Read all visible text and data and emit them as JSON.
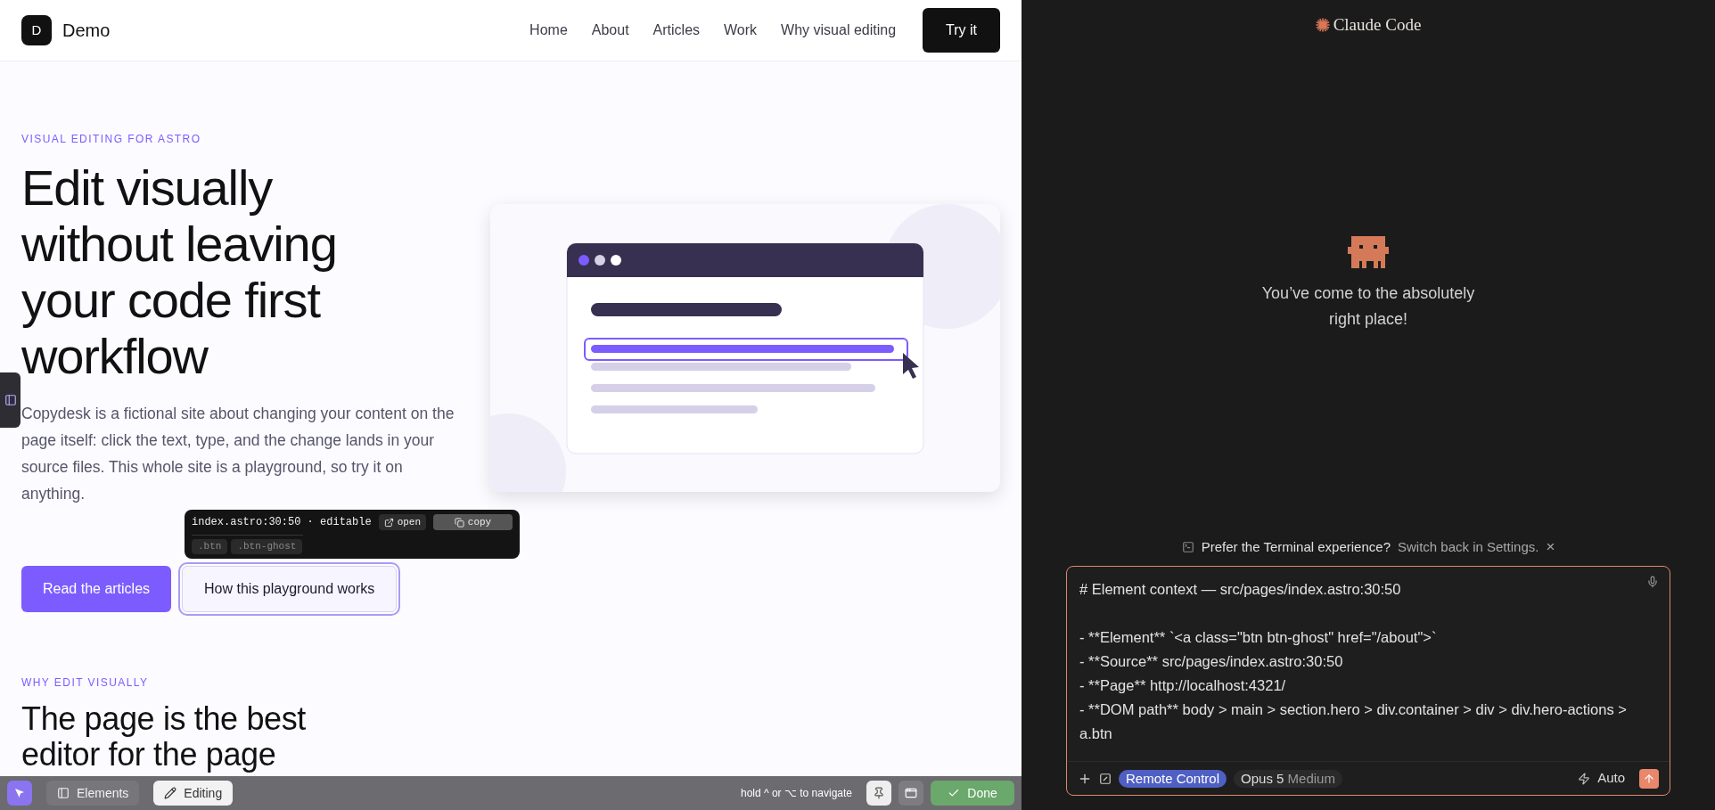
{
  "site": {
    "logo_letter": "D",
    "name": "Demo",
    "nav": [
      "Home",
      "About",
      "Articles",
      "Work",
      "Why visual editing"
    ],
    "cta": "Try it"
  },
  "hero": {
    "eyebrow": "VISUAL EDITING FOR ASTRO",
    "heading_lines": [
      "Edit visually",
      "without leaving",
      "your code first",
      "workflow"
    ],
    "paragraph": "Copydesk is a fictional site about changing your content on the page itself: click the text, type, and the change lands in your source files. This whole site is a playground, so try it on anything.",
    "buttons": [
      {
        "label": "Read the articles",
        "kind": "primary",
        "selected": false
      },
      {
        "label": "How this playground works",
        "kind": "ghost",
        "selected": true
      }
    ]
  },
  "inspector_tooltip": {
    "location": "index.astro:30:50 · editable",
    "actions": [
      "open",
      "copy"
    ],
    "classes": [
      ".btn",
      ".btn-ghost"
    ]
  },
  "section": {
    "eyebrow": "WHY EDIT VISUALLY",
    "heading_lines": [
      "The page is the best",
      "editor for the page"
    ]
  },
  "editor_toolbar": {
    "tabs": [
      {
        "label": "Elements",
        "selected": false
      },
      {
        "label": "Editing",
        "selected": true
      }
    ],
    "hint": "hold ^ or ⌥ to navigate",
    "done": "Done"
  },
  "claude": {
    "brand": "Claude Code",
    "greeting": "You’ve come to the absolutely right place!",
    "notice": {
      "text": "Prefer the Terminal experience?",
      "link": "Switch back in Settings.",
      "close": "×"
    },
    "prompt_heading": "# Element context — src/pages/index.astro:30:50",
    "prompt_lines": [
      "- **Element** `<a class=\"btn btn-ghost\" href=\"/about\">`",
      "- **Source** src/pages/index.astro:30:50",
      "- **Page** http://localhost:4321/",
      "- **DOM path** body > main > section.hero > div.container > div > div.hero-actions > a.btn"
    ],
    "remote_control": "Remote Control",
    "model": "Opus 5",
    "effort": "Medium",
    "mode": "Auto"
  }
}
